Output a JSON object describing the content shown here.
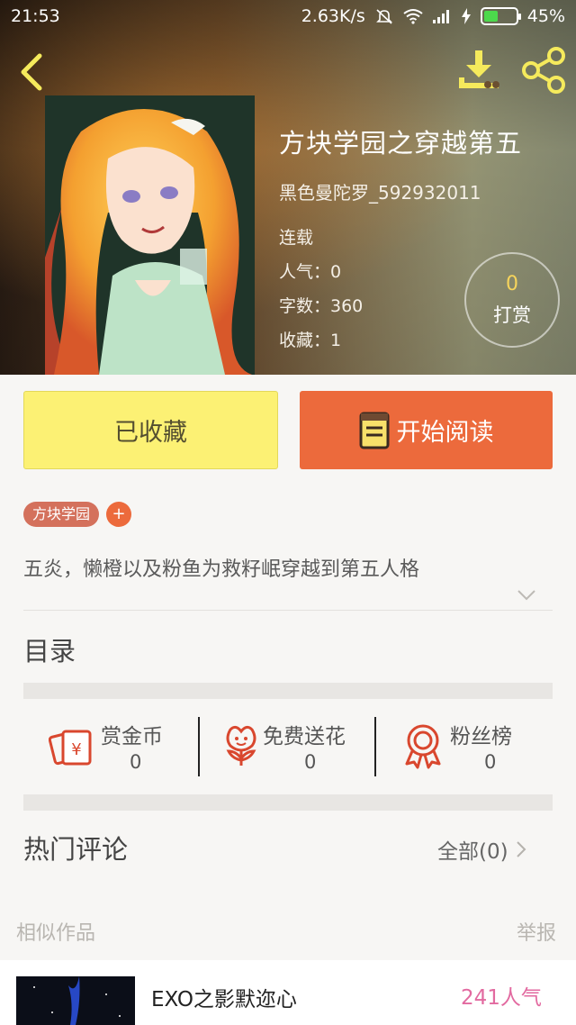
{
  "status_bar": {
    "time": "21:53",
    "speed": "2.63K/s",
    "battery": "45%",
    "battery_level": 0.45
  },
  "book": {
    "title": "方块学园之穿越第五",
    "author": "黑色曼陀罗_592932011",
    "status": "连载",
    "popularity": "人气：0",
    "word_count": "字数：360",
    "favorites": "收藏：1"
  },
  "tip": {
    "count": "0",
    "label": "打赏"
  },
  "actions": {
    "collected_label": "已收藏",
    "read_label": "开始阅读"
  },
  "tags": [
    "方块学园"
  ],
  "tag_add": "+",
  "synopsis": "五炎，懒橙以及粉鱼为救籽岷穿越到第五人格",
  "toc_title": "目录",
  "stats": [
    {
      "label": "赏金币",
      "value": "0"
    },
    {
      "label": "免费送花",
      "value": "0"
    },
    {
      "label": "粉丝榜",
      "value": "0"
    }
  ],
  "comments": {
    "title": "热门评论",
    "all_label": "全部(0)"
  },
  "similar": {
    "title": "相似作品",
    "report": "举报",
    "items": [
      {
        "title": "EXO之影默迩心",
        "popularity": "241人气"
      }
    ]
  },
  "colors": {
    "accent_orange": "#ec6a3c",
    "collected_yellow": "#fcf174",
    "tag_color": "#d4715c",
    "popularity_pink": "#e26aa0",
    "tip_yellow": "#f6d45c"
  },
  "icons": [
    "back-arrow-icon",
    "download-icon",
    "share-icon",
    "book-icon",
    "coin-envelope-icon",
    "flower-icon",
    "ribbon-award-icon",
    "chevron-down-icon",
    "chevron-right-icon"
  ]
}
